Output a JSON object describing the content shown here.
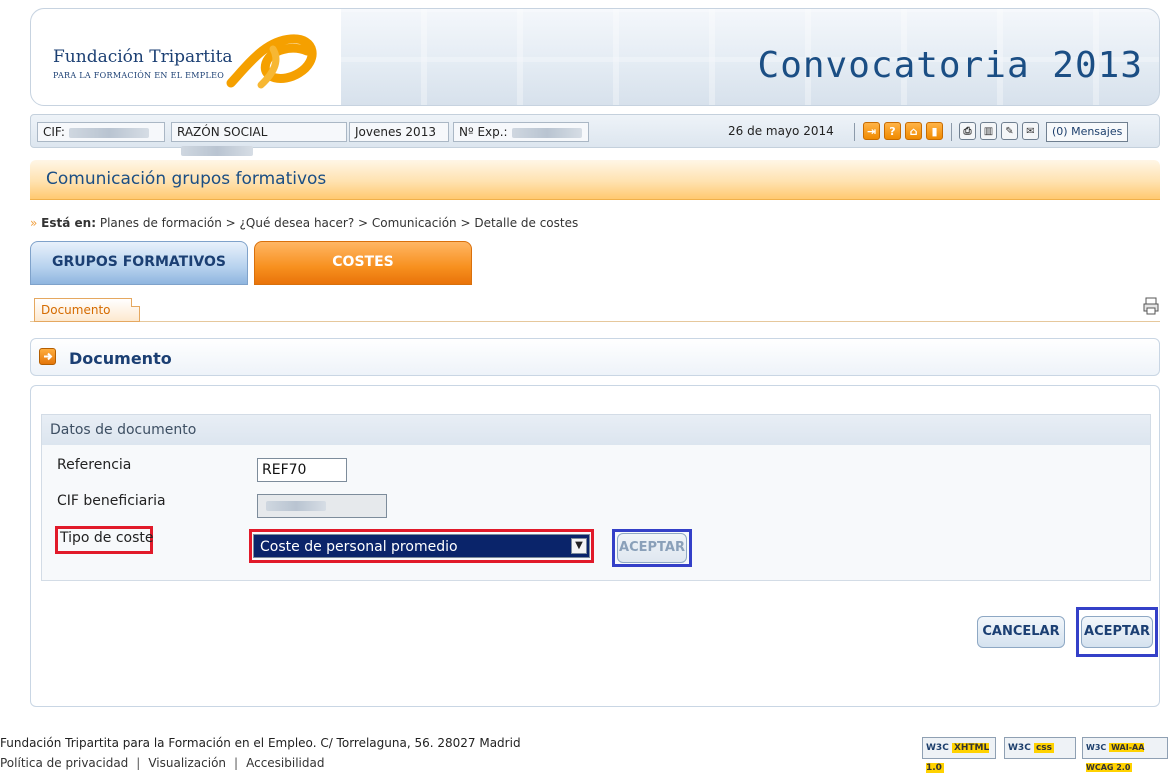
{
  "header": {
    "org_name": "Fundación Tripartita",
    "org_tagline": "PARA LA FORMACIÓN EN EL EMPLEO",
    "title": "Convocatoria 2013"
  },
  "infobar": {
    "cif_label": "CIF:",
    "razon_label": "RAZÓN SOCIAL",
    "program": "Jovenes 2013",
    "exp_label": "Nº Exp.:",
    "date": "26 de mayo 2014",
    "messages": "(0) Mensajes"
  },
  "section": {
    "title": "Comunicación grupos formativos"
  },
  "breadcrumb": {
    "prefix": "Está en:",
    "path": "Planes de formación > ¿Qué desea hacer? > Comunicación > Detalle de costes"
  },
  "tabs": [
    {
      "label": "GRUPOS FORMATIVOS"
    },
    {
      "label": "COSTES"
    }
  ],
  "subtab": {
    "label": "Documento"
  },
  "document": {
    "title": "Documento",
    "fieldset_title": "Datos de documento",
    "fields": {
      "referencia_label": "Referencia",
      "referencia_value": "REF70",
      "cif_label": "CIF beneficiaria",
      "tipo_label": "Tipo de coste",
      "tipo_value": "Coste de personal promedio"
    },
    "inline_accept": "ACEPTAR",
    "cancel": "CANCELAR",
    "accept": "ACEPTAR"
  },
  "footer": {
    "address": "Fundación Tripartita para la Formación en el Empleo. C/ Torrelaguna, 56. 28027 Madrid",
    "links": [
      "Política de privacidad",
      "Visualización",
      "Accesibilidad"
    ],
    "badges": [
      {
        "left": "W3C",
        "right": "XHTML 1.0"
      },
      {
        "left": "W3C",
        "right": "css"
      },
      {
        "left": "W3C",
        "right": "WAI-AA WCAG 2.0"
      }
    ]
  }
}
